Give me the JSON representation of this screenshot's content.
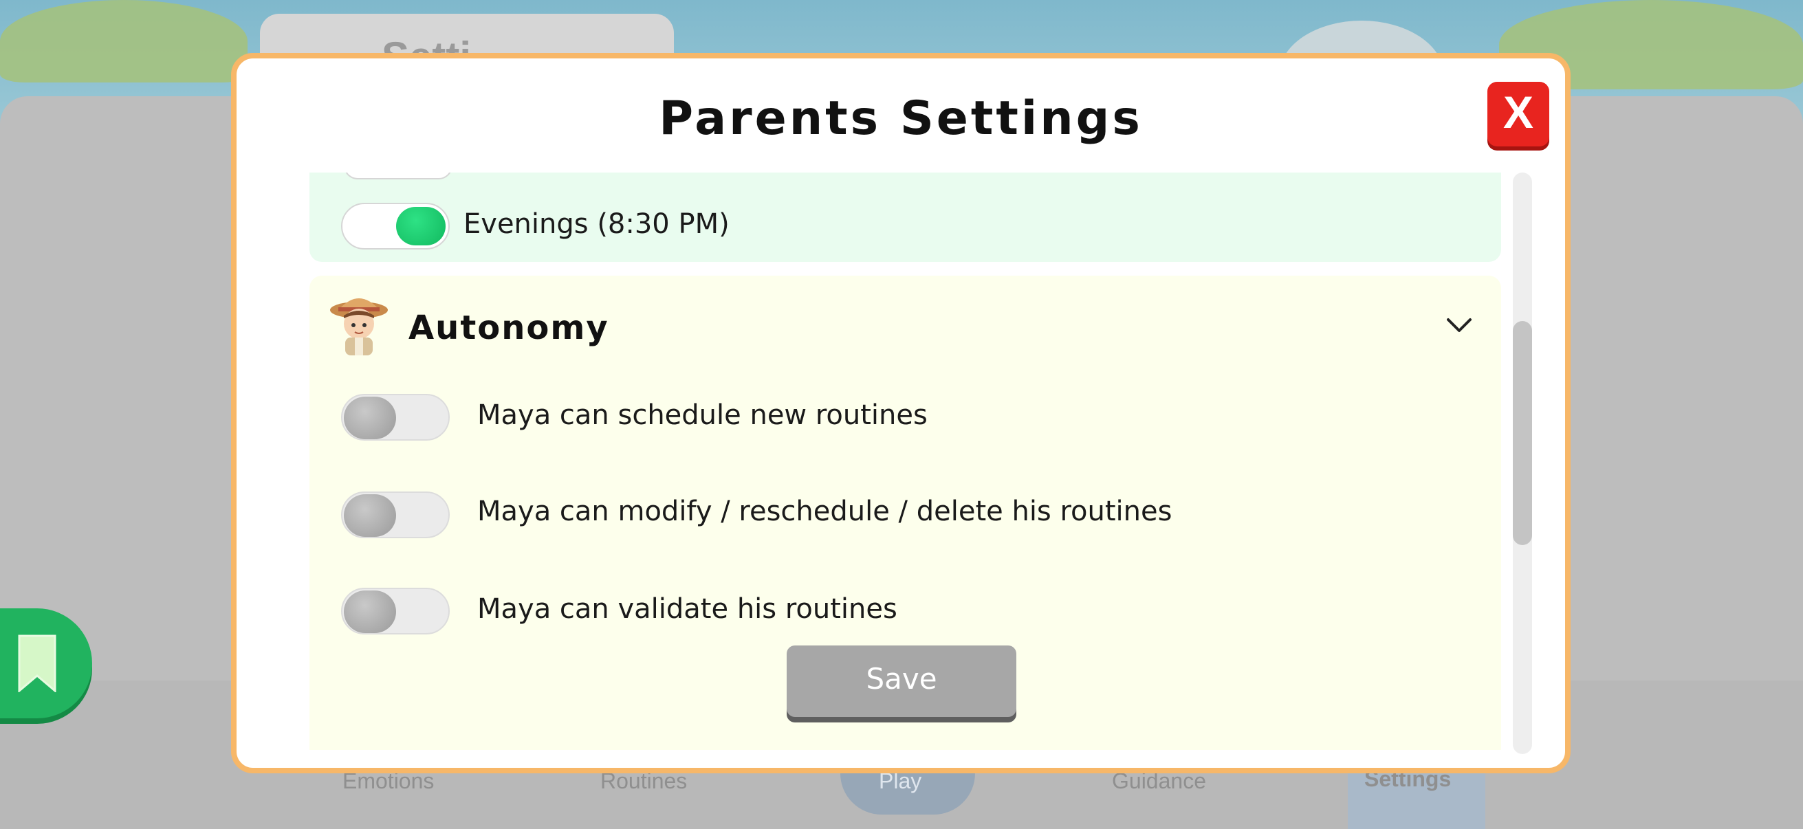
{
  "background": {
    "partial_tab_text": "Setti",
    "bottom_nav": [
      {
        "label": "Emotions"
      },
      {
        "label": "Routines"
      },
      {
        "label": "Play"
      },
      {
        "label": "Guidance"
      },
      {
        "label": "Settings"
      }
    ]
  },
  "modal": {
    "title": "Parents Settings",
    "close_label": "X",
    "reminders": {
      "evenings_label": "Evenings (8:30 PM)",
      "evenings_on": true
    },
    "autonomy": {
      "title": "Autonomy",
      "avatar_icon": "boy-explorer-avatar",
      "expand_icon": "chevron-down-icon",
      "options": [
        {
          "label": "Maya can schedule new routines",
          "on": false
        },
        {
          "label": "Maya can modify / reschedule / delete his routines",
          "on": false
        },
        {
          "label": "Maya can validate his routines",
          "on": false
        }
      ]
    },
    "save_label": "Save"
  },
  "colors": {
    "modal_border": "#f7b768",
    "close_red": "#e8241f",
    "toggle_on": "#12b95f",
    "green_section": "#e9fcef",
    "yellow_section": "#fdffec",
    "save_gray": "#a7a7a7"
  }
}
